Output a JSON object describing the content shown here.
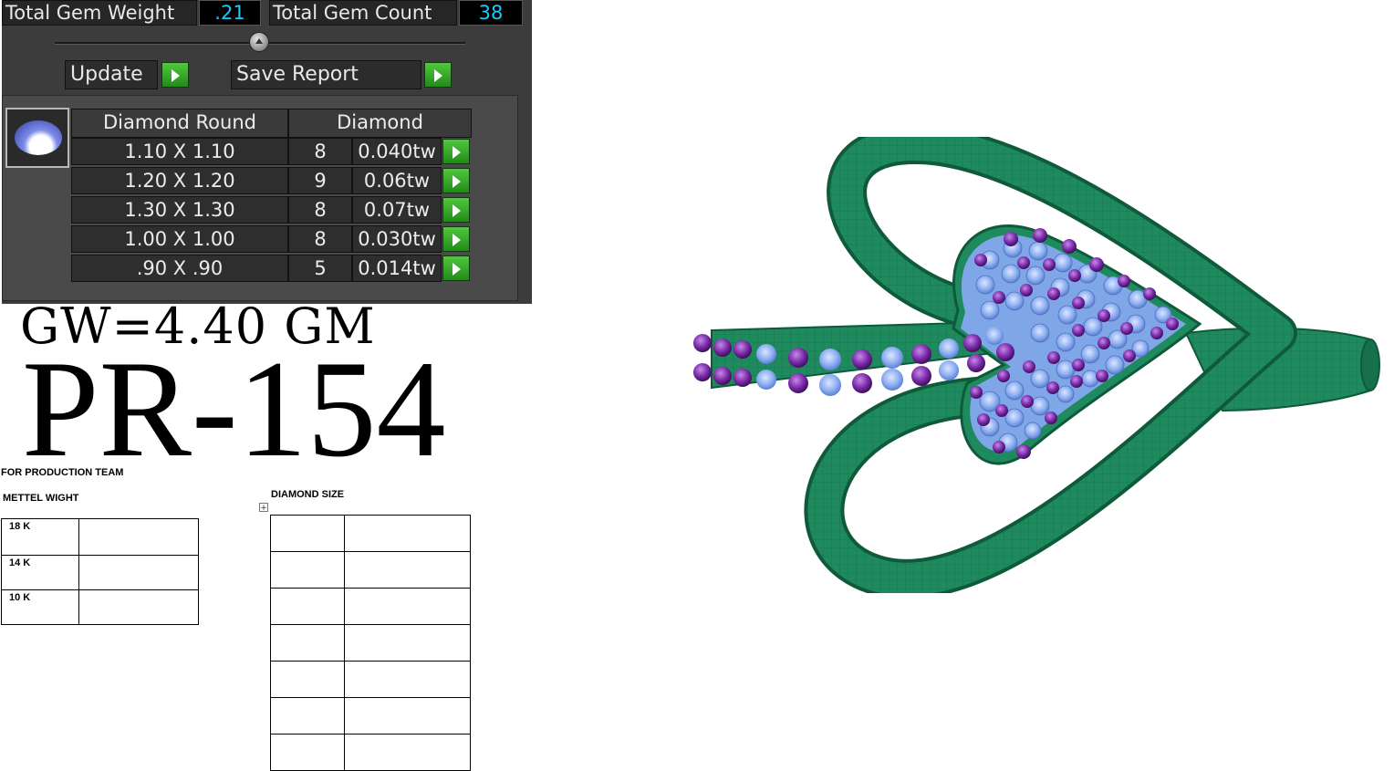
{
  "gem_panel": {
    "total_weight_label": "Total Gem Weight",
    "total_weight_value": ".21",
    "total_count_label": "Total Gem Count",
    "total_count_value": "38",
    "update_label": "Update",
    "save_report_label": "Save Report",
    "columns": [
      "Diamond Round",
      "Diamond"
    ],
    "rows": [
      {
        "size": "1.10 X 1.10",
        "count": "8",
        "weight": "0.040tw"
      },
      {
        "size": "1.20 X 1.20",
        "count": "9",
        "weight": "0.06tw"
      },
      {
        "size": "1.30 X 1.30",
        "count": "8",
        "weight": "0.07tw"
      },
      {
        "size": "1.00 X 1.00",
        "count": "8",
        "weight": "0.030tw"
      },
      {
        "size": ".90 X .90",
        "count": "5",
        "weight": "0.014tw"
      }
    ]
  },
  "gross_weight": "GW=4.40 GM",
  "design_code": "PR-154",
  "production": {
    "heading": "FOR PRODUCTION TEAM",
    "metal_heading": "METTEL WIGHT",
    "metal_rows": [
      "18 K",
      "14 K",
      "10 K"
    ],
    "diamond_heading": "DIAMOND SIZE"
  },
  "colors": {
    "metal": "#1f8a5e",
    "metal_dark": "#0f5a3a",
    "stone_blue": "#8fb0f2",
    "stone_purple": "#7b2aa8",
    "value_text": "#1ec8ff",
    "go_button": "#3cb32a"
  }
}
